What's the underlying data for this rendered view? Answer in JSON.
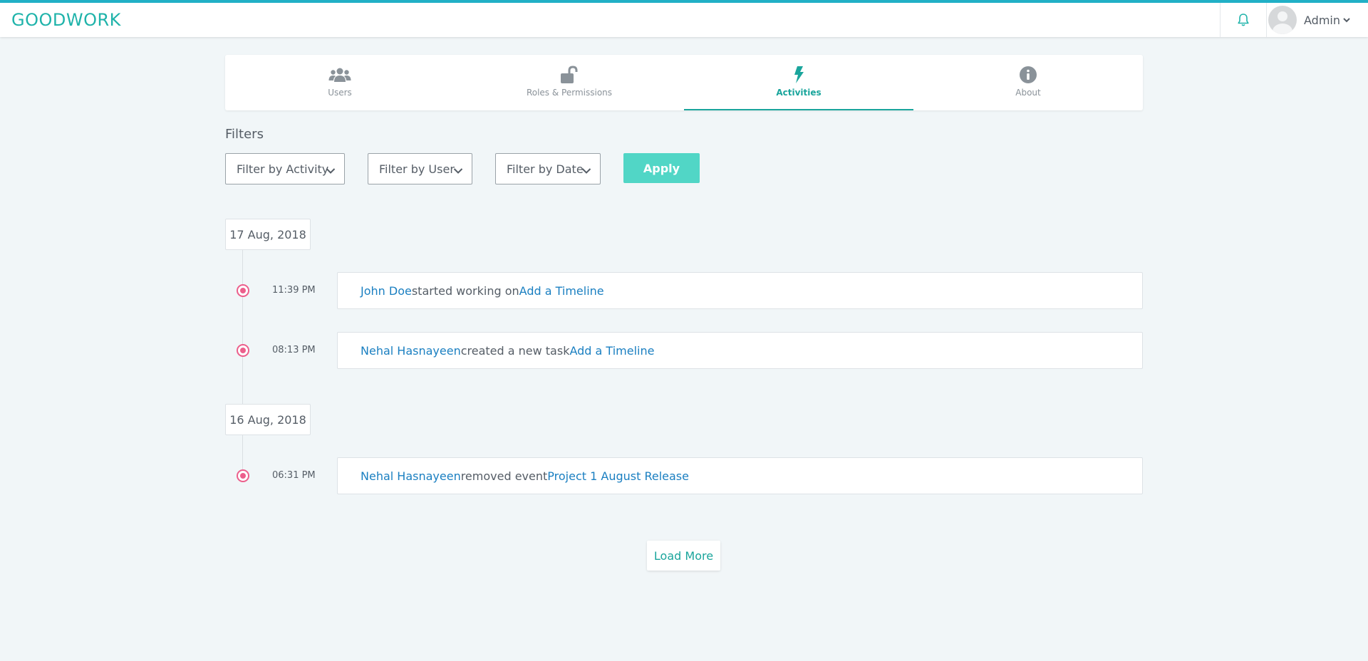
{
  "header": {
    "brand": "GOODWORK",
    "user_name": "Admin",
    "icons": {
      "notifications": "bell-icon",
      "user_menu": "chevron-down-icon"
    }
  },
  "tabs": [
    {
      "label": "Users",
      "icon": "users-icon",
      "active": false
    },
    {
      "label": "Roles & Permissions",
      "icon": "unlock-icon",
      "active": false
    },
    {
      "label": "Activities",
      "icon": "bolt-icon",
      "active": true
    },
    {
      "label": "About",
      "icon": "info-circle-icon",
      "active": false
    }
  ],
  "filters": {
    "title": "Filters",
    "activity": "Filter by Activity",
    "user": "Filter by User",
    "date": "Filter by Date",
    "apply_label": "Apply"
  },
  "timeline": [
    {
      "date": "17 Aug, 2018",
      "items": [
        {
          "time": "11:39 PM",
          "user": "John Doe",
          "action": "started working on",
          "target": "Add a Timeline"
        },
        {
          "time": "08:13 PM",
          "user": "Nehal Hasnayeen",
          "action": "created a new task",
          "target": "Add a Timeline"
        }
      ]
    },
    {
      "date": "16 Aug, 2018",
      "items": [
        {
          "time": "06:31 PM",
          "user": "Nehal Hasnayeen",
          "action": "removed event",
          "target": "Project 1 August Release"
        }
      ]
    }
  ],
  "load_more_label": "Load More",
  "colors": {
    "brand": "#1fb3aa",
    "accent": "#1aa59c",
    "link": "#1a7fc1",
    "apply_button": "#51d6c6",
    "timeline_dot": "#ec5f8c",
    "top_border": "#21b0c6"
  }
}
